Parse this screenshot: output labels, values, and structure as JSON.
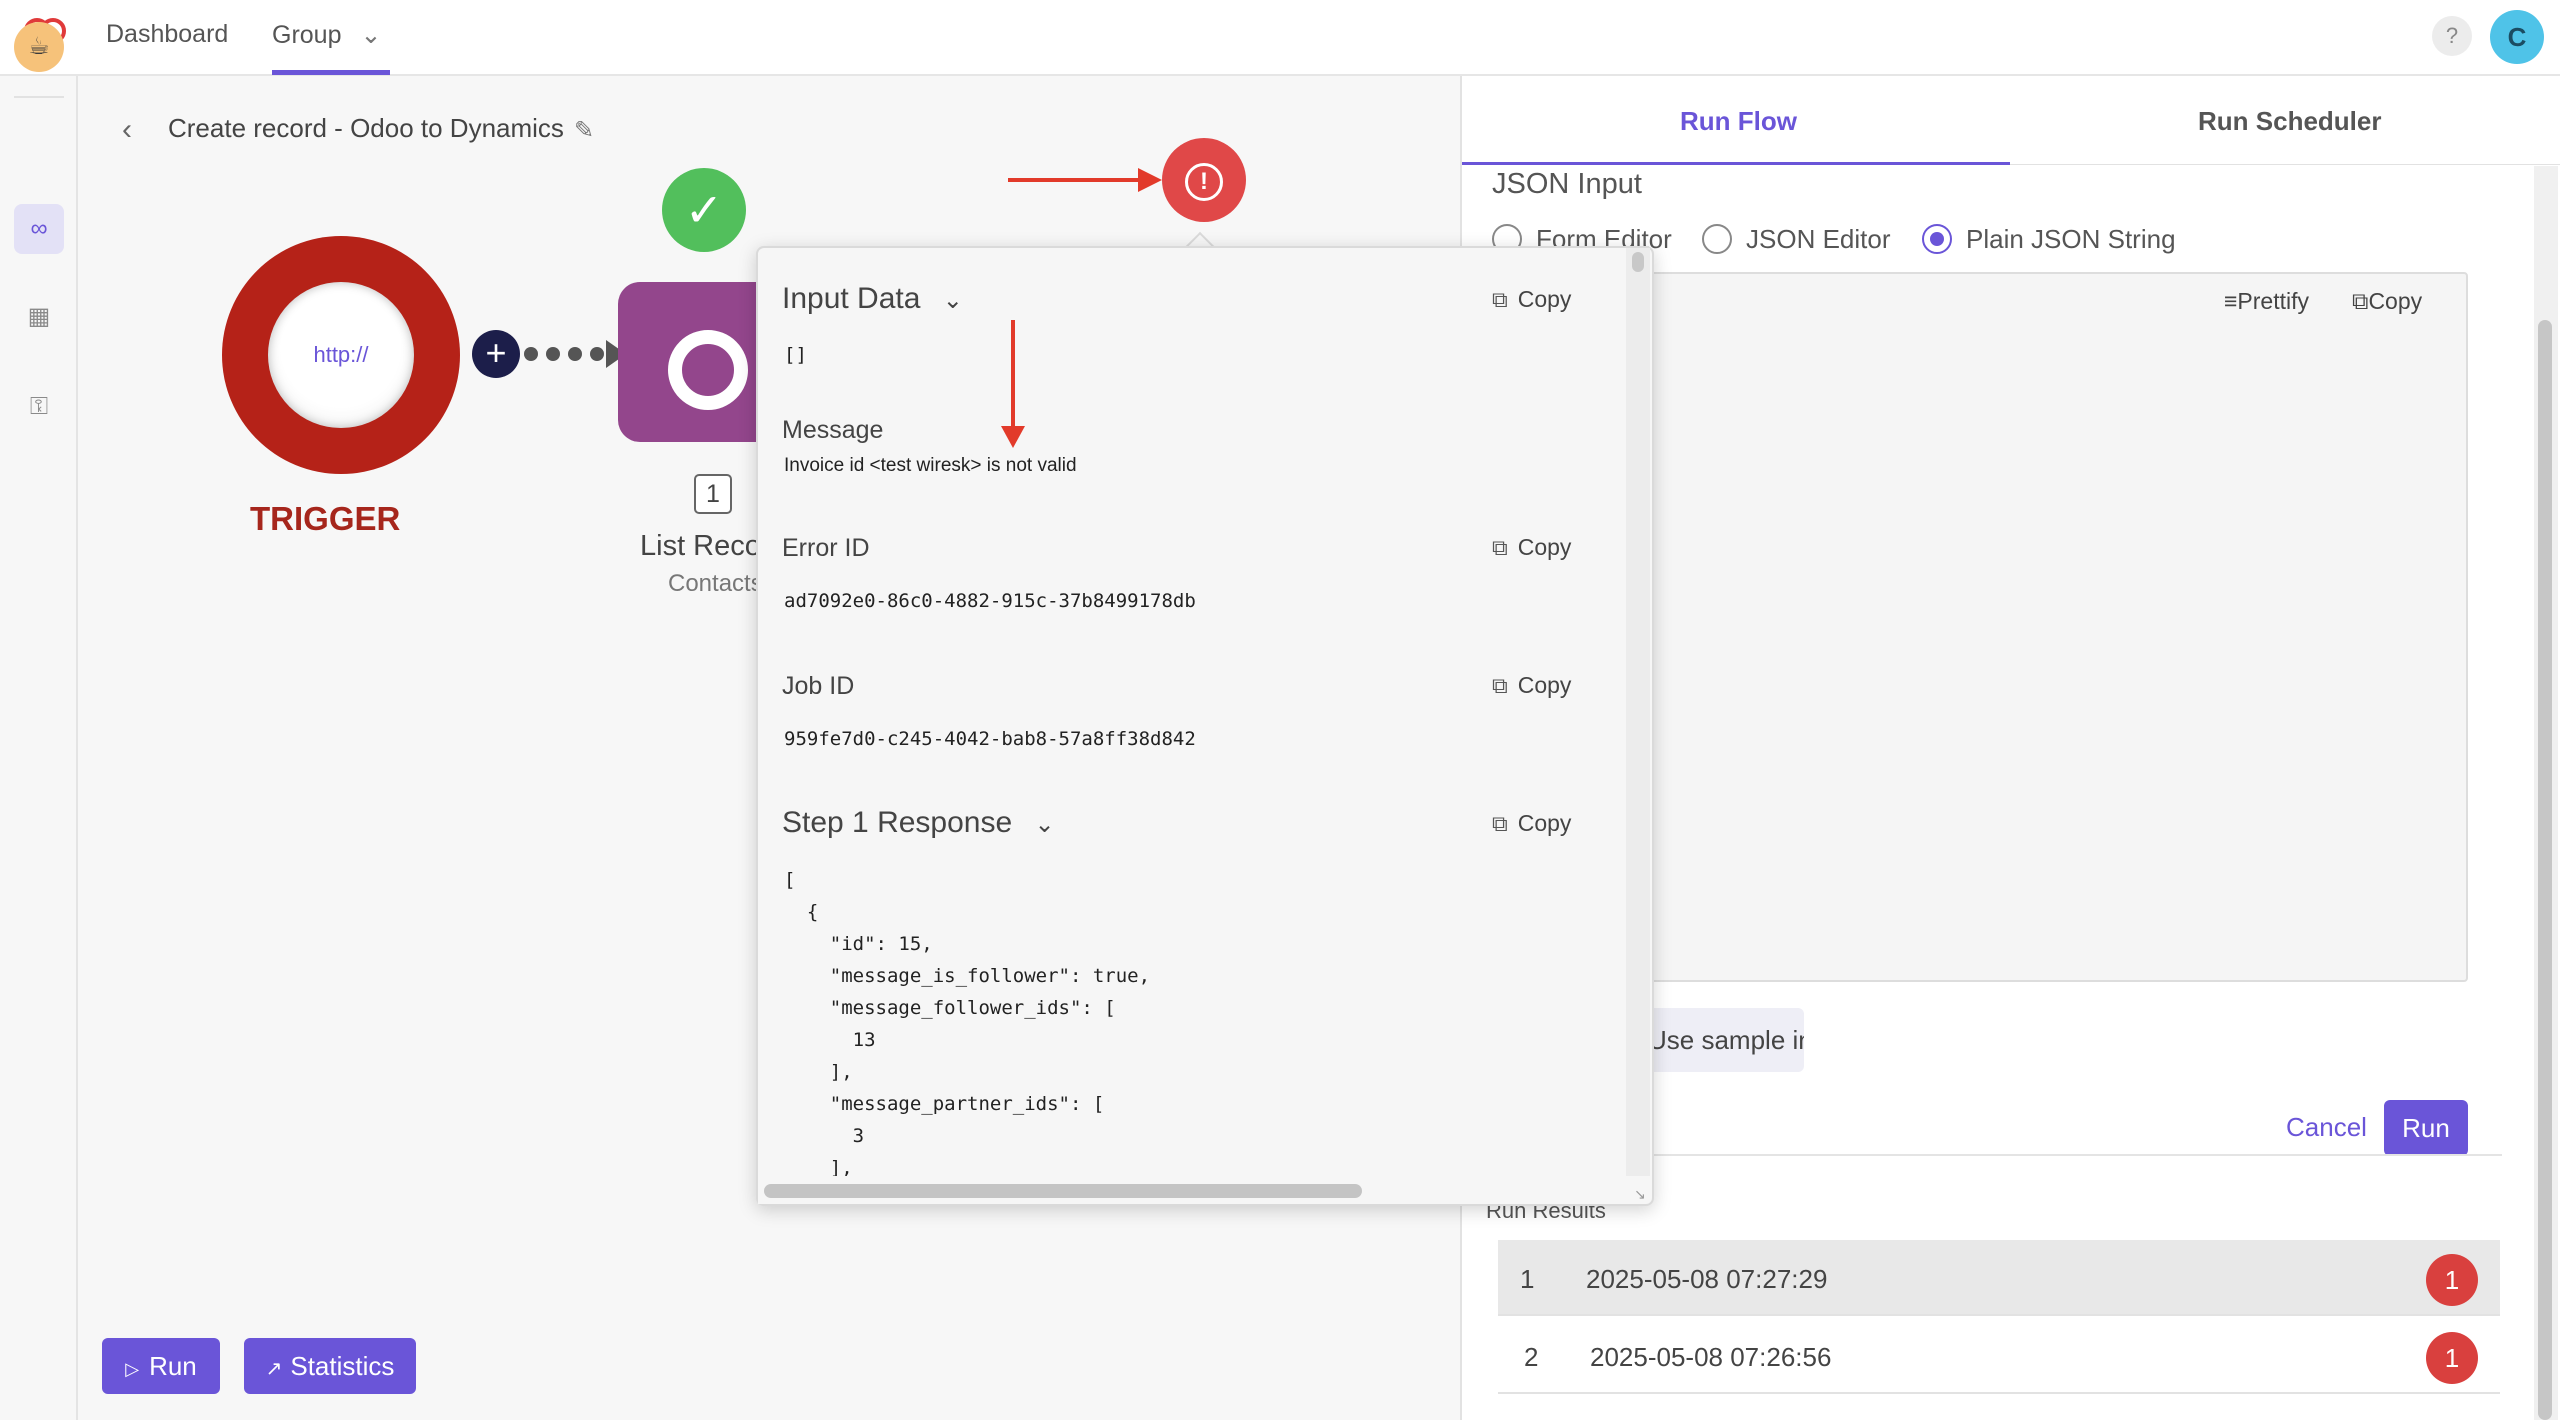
{
  "topbar": {
    "nav": [
      "Dashboard",
      "Group"
    ],
    "help": "?",
    "avatar_initial": "C"
  },
  "rail": {
    "items": [
      "flows-icon",
      "apps-grid-icon",
      "key-icon"
    ]
  },
  "canvas": {
    "flow_title": "Create record - Odoo to Dynamics",
    "trigger_text": "http://",
    "trigger_label": "TRIGGER",
    "step_number": "1",
    "step_title": "List Records",
    "step_subtitle": "Contacts",
    "run_label": "Run",
    "statistics_label": "Statistics"
  },
  "popup": {
    "input_data_title": "Input Data",
    "input_data_value": "[]",
    "message_label": "Message",
    "message_value": "Invoice id <test wiresk> is not valid",
    "error_id_label": "Error ID",
    "error_id_value": "ad7092e0-86c0-4882-915c-37b8499178db",
    "job_id_label": "Job ID",
    "job_id_value": "959fe7d0-c245-4042-bab8-57a8ff38d842",
    "step_response_title": "Step 1 Response",
    "copy_label": "Copy",
    "step_response_json": "[\n  {\n    \"id\": 15,\n    \"message_is_follower\": true,\n    \"message_follower_ids\": [\n      13\n    ],\n    \"message_partner_ids\": [\n      3\n    ],"
  },
  "right_panel": {
    "tabs": [
      "Run Flow",
      "Run Scheduler"
    ],
    "json_input_label": "JSON Input",
    "radio_options": [
      "Form Editor",
      "JSON Editor",
      "Plain JSON String"
    ],
    "selected_radio": "Plain JSON String",
    "prettify_label": "Prettify",
    "copy_label": "Copy",
    "sample_input_label": "Use sample input",
    "cancel_label": "Cancel",
    "run_label": "Run",
    "run_results_label": "Run Results",
    "run_results": [
      {
        "index": "1",
        "time": "2025-05-08 07:27:29",
        "errors": "1"
      },
      {
        "index": "2",
        "time": "2025-05-08 07:26:56",
        "errors": "1"
      }
    ]
  },
  "colors": {
    "accent": "#6a55d8",
    "trigger": "#b52218",
    "error": "#e04848",
    "success": "#52bf5c",
    "step": "#93468c"
  }
}
